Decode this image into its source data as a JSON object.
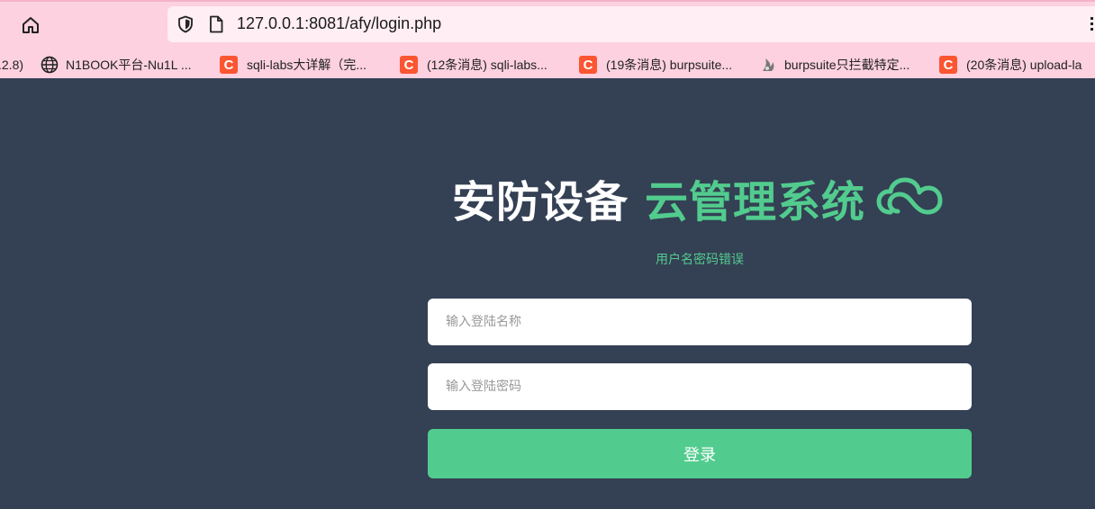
{
  "browser": {
    "url": "127.0.0.1:8081/afy/login.php",
    "bookmarks": [
      {
        "label": ".2.8)",
        "icon": "none"
      },
      {
        "label": "N1BOOK平台-Nu1L ...",
        "icon": "globe-icon"
      },
      {
        "label": "sqli-labs大详解（完...",
        "icon": "csdn-icon"
      },
      {
        "label": "(12条消息) sqli-labs...",
        "icon": "csdn-icon"
      },
      {
        "label": "(19条消息) burpsuite...",
        "icon": "csdn-icon"
      },
      {
        "label": "burpsuite只拦截特定...",
        "icon": "burp-icon"
      },
      {
        "label": "(20条消息) upload-la",
        "icon": "csdn-icon"
      }
    ]
  },
  "login": {
    "title_part1": "安防设备",
    "title_part2": "云管理系统",
    "error_message": "用户名密码错误",
    "username_placeholder": "输入登陆名称",
    "password_placeholder": "输入登陆密码",
    "submit_label": "登录"
  },
  "colors": {
    "page_bg": "#344054",
    "accent_green": "#52cc8e",
    "browser_pink": "#fdd1df",
    "csdn_red": "#fc5531"
  }
}
